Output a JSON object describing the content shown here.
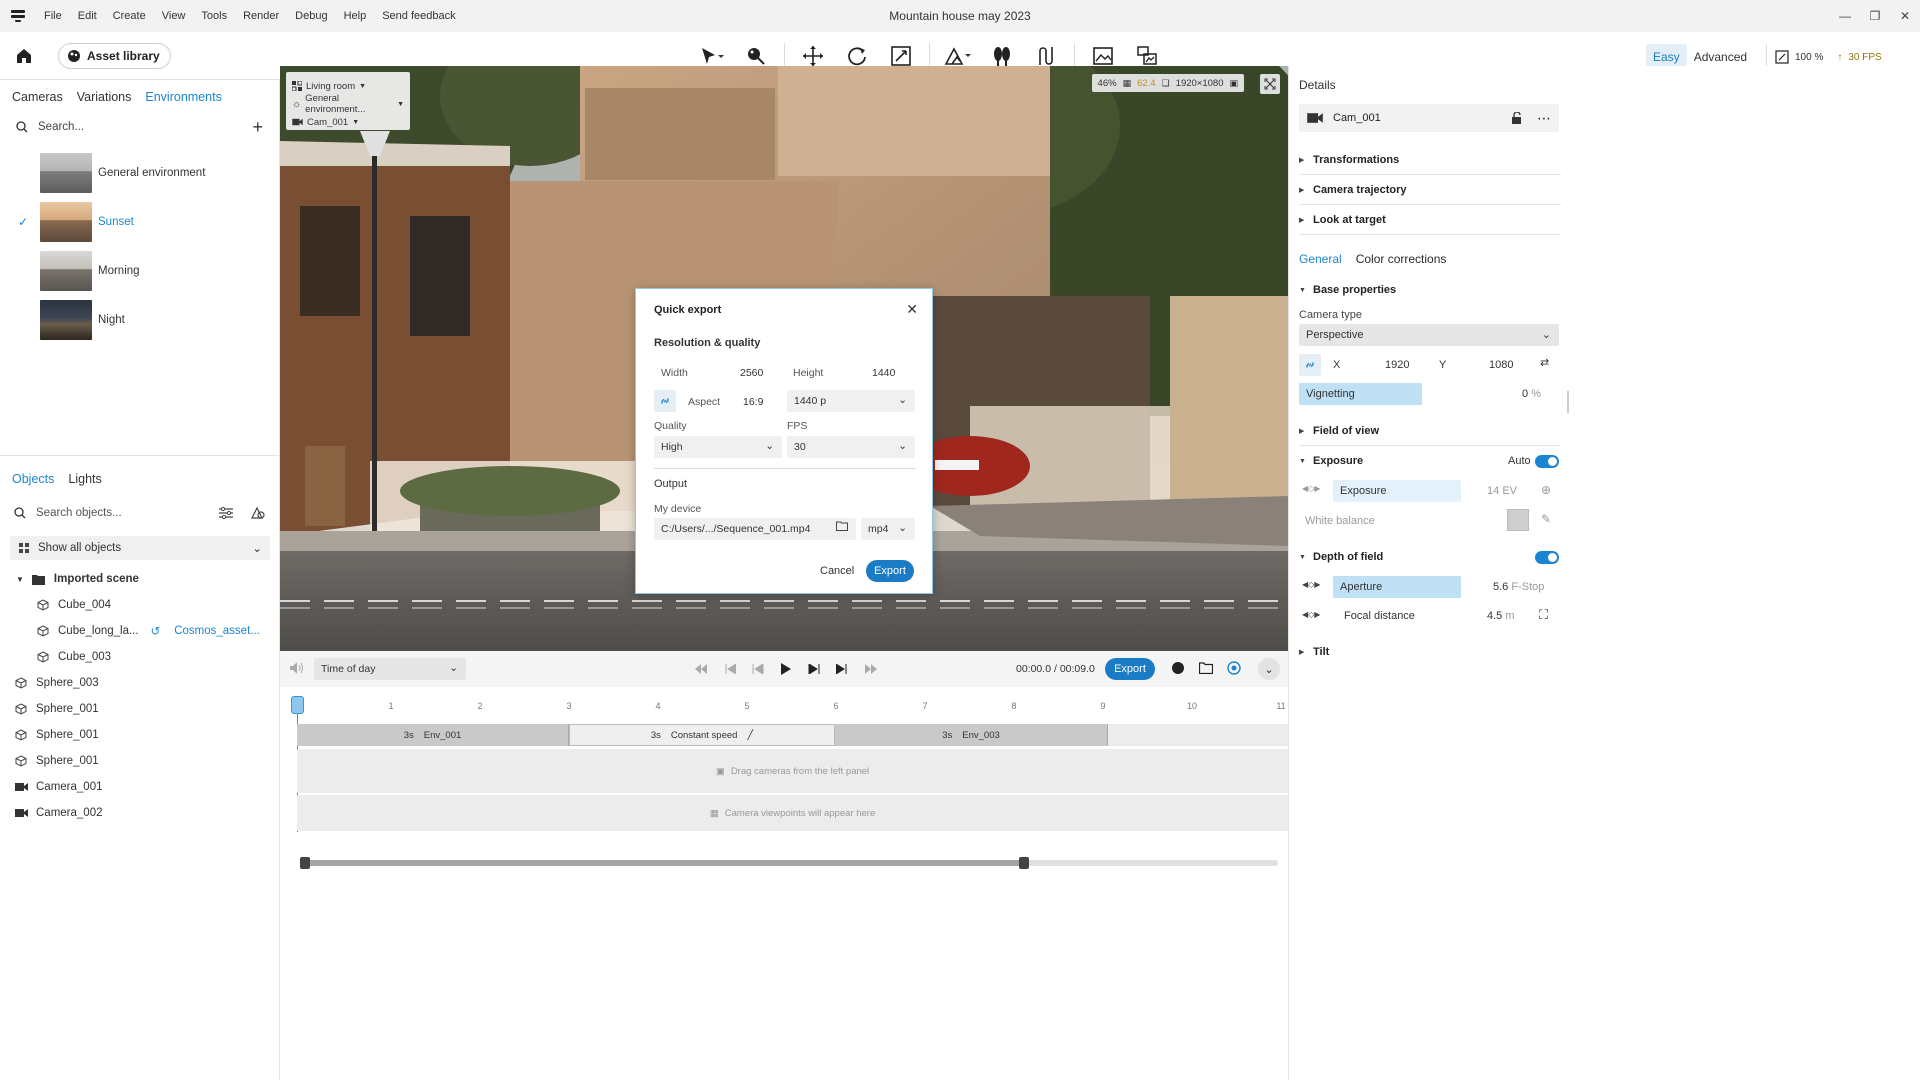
{
  "window": {
    "title": "Mountain house may 2023"
  },
  "menu": [
    "File",
    "Edit",
    "Create",
    "View",
    "Tools",
    "Render",
    "Debug",
    "Help",
    "Send feedback"
  ],
  "toolbar": {
    "asset_library": "Asset library",
    "mode_easy": "Easy",
    "mode_advanced": "Advanced",
    "zoom": "100 %",
    "fps": "30 FPS",
    "tools": [
      "select-arrow-icon",
      "paint-tool-icon",
      "move-icon",
      "rotate-icon",
      "scale-icon",
      "terrain-icon",
      "vegetation-icon",
      "path-icon",
      "render-image-icon",
      "render-batch-icon"
    ]
  },
  "left_panel": {
    "tabs": [
      "Cameras",
      "Variations",
      "Environments"
    ],
    "active_tab": "Environments",
    "search_placeholder": "Search...",
    "environments": [
      {
        "label": "General environment",
        "selected": false
      },
      {
        "label": "Sunset",
        "selected": true
      },
      {
        "label": "Morning",
        "selected": false
      },
      {
        "label": "Night",
        "selected": false
      }
    ],
    "object_tabs": [
      "Objects",
      "Lights"
    ],
    "objects_search_placeholder": "Search objects...",
    "show_filter": "Show all objects",
    "tree": {
      "group": "Imported scene",
      "children": [
        "Cube_004",
        "Cube_long_la...",
        "Cube_003"
      ],
      "child_link": "Cosmos_asset...",
      "root_items": [
        "Sphere_003",
        "Sphere_001",
        "Sphere_001",
        "Sphere_001",
        "Camera_001",
        "Camera_002"
      ]
    }
  },
  "viewport": {
    "overlay": {
      "room": "Living room",
      "environment": "General environment...",
      "camera": "Cam_001"
    },
    "stats": {
      "quality": "46%",
      "warn": "62.4",
      "resolution": "1920×1080"
    }
  },
  "dialog": {
    "title": "Quick export",
    "section_resolution": "Resolution & quality",
    "width_label": "Width",
    "width_value": "2560",
    "height_label": "Height",
    "height_value": "1440",
    "aspect_label": "Aspect",
    "aspect_value": "16:9",
    "preset": "1440 p",
    "quality_label": "Quality",
    "quality_value": "High",
    "fps_label": "FPS",
    "fps_value": "30",
    "section_output": "Output",
    "device_label": "My device",
    "path": "C:/Users/.../Sequence_001.mp4",
    "format": "mp4",
    "cancel": "Cancel",
    "export": "Export"
  },
  "timeline": {
    "time_of_day": "Time of day",
    "current_time": "00:00.0",
    "total_time": "00:09.0",
    "export": "Export",
    "ruler_ticks": [
      "1",
      "2",
      "3",
      "4",
      "5",
      "6",
      "7",
      "8",
      "9",
      "10",
      "11"
    ],
    "clips": [
      {
        "duration": "3s",
        "label": "Env_001",
        "kind": "env"
      },
      {
        "duration": "3s",
        "label": "Constant speed",
        "kind": "transition"
      },
      {
        "duration": "3s",
        "label": "Env_003",
        "kind": "env"
      }
    ],
    "camera_hint": "Drag cameras from the left panel",
    "viewpoint_hint": "Camera viewpoints will appear here",
    "scroll_fraction": 0.74
  },
  "right_panel": {
    "title": "Details",
    "camera_name": "Cam_001",
    "sections_top": [
      "Transformations",
      "Camera trajectory",
      "Look at target"
    ],
    "subtabs": [
      "General",
      "Color corrections"
    ],
    "base_properties": "Base properties",
    "camera_type_label": "Camera type",
    "camera_type": "Perspective",
    "x_label": "X",
    "x_value": "1920",
    "y_label": "Y",
    "y_value": "1080",
    "vignetting_label": "Vignetting",
    "vignetting_value": "0",
    "vignetting_unit": "%",
    "field_of_view": "Field of view",
    "exposure_section": "Exposure",
    "exposure_auto": "Auto",
    "exposure_label": "Exposure",
    "exposure_value": "14",
    "exposure_unit": "EV",
    "white_balance": "White balance",
    "dof_section": "Depth of field",
    "aperture_label": "Aperture",
    "aperture_value": "5.6",
    "aperture_unit": "F-Stop",
    "focal_label": "Focal distance",
    "focal_value": "4.5",
    "focal_unit": "m",
    "tilt": "Tilt"
  }
}
